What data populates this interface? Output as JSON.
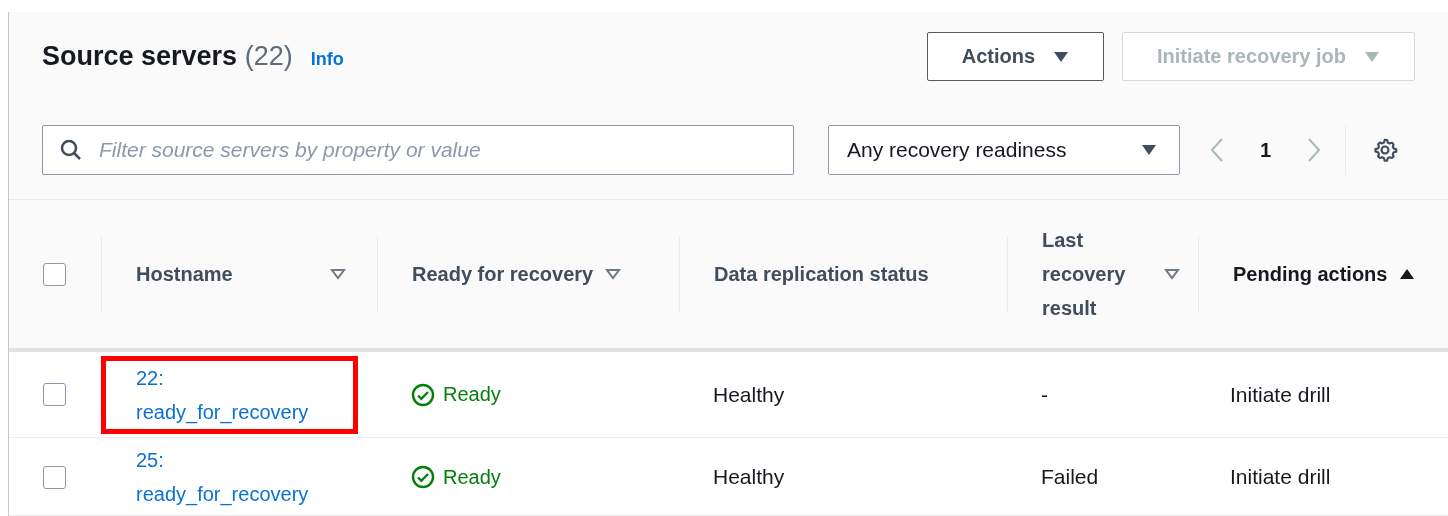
{
  "header": {
    "title": "Source servers",
    "count": "(22)",
    "info_link": "Info",
    "buttons": [
      {
        "label": "Actions",
        "disabled": false
      },
      {
        "label": "Initiate recovery job",
        "disabled": true
      }
    ]
  },
  "filter": {
    "placeholder": "Filter source servers by property or value"
  },
  "readiness_select": {
    "value": "Any recovery readiness"
  },
  "pagination": {
    "pages": [
      {
        "label": "1",
        "selected": true
      }
    ]
  },
  "table": {
    "select_all": {
      "checked": false
    },
    "columns": [
      {
        "label": "Hostname",
        "sortable": true,
        "sorted": false
      },
      {
        "label": "Ready for recovery",
        "sortable": true,
        "sorted": false
      },
      {
        "label": "Data replication status",
        "sortable": false,
        "sorted": false
      },
      {
        "label": "Last recovery result",
        "sortable": true,
        "sorted": false
      },
      {
        "label": "Pending actions",
        "sortable": true,
        "sorted": true
      }
    ],
    "rows": [
      {
        "checked": false,
        "hostname": "22: ready_for_recovery",
        "highlighted": true,
        "ready": {
          "ok": true,
          "label": "Ready"
        },
        "replication": "Healthy",
        "last_result": "-",
        "pending": "Initiate drill"
      },
      {
        "checked": false,
        "hostname": "25: ready_for_recovery",
        "highlighted": false,
        "ready": {
          "ok": true,
          "label": "Ready"
        },
        "replication": "Healthy",
        "last_result": "Failed",
        "pending": "Initiate drill"
      }
    ]
  }
}
